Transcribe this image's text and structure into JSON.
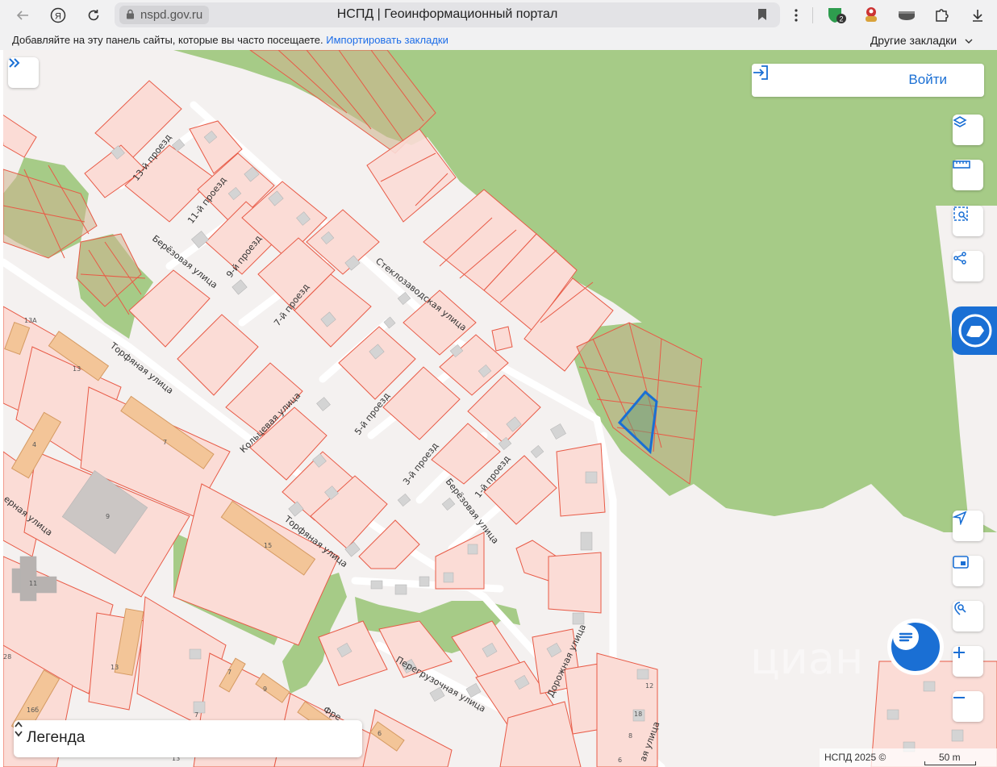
{
  "browser": {
    "url": "nspd.gov.ru",
    "title": "НСПД | Геоинформационный портал",
    "bookmarks_hint": "Добавляйте на эту панель сайты, которые вы часто посещаете.",
    "import_link": "Импортировать закладки",
    "other_bookmarks": "Другие закладки",
    "extension_badge": "2"
  },
  "map": {
    "login_label": "Войти",
    "legend_label": "Легенда",
    "copyright": "НСПД 2025 ©",
    "scale": "50 m",
    "watermark": "циан",
    "streets": {
      "s13": "13-й проезд",
      "s11": "11-й проезд",
      "s9": "9-й проезд",
      "s7": "7-й проезд",
      "s5": "5-й проезд",
      "s3": "3-й проезд",
      "s1": "1-й проезд",
      "berez1": "Берёзовая улица",
      "berez2": "Берёзовая улица",
      "steklo": "Стеклозаводская улица",
      "torf1": "Торфяная улица",
      "torf2": "Торфяная улица",
      "kolts": "Кольцевая улица",
      "pereg": "Перегрузочная улица",
      "dorozh": "Дорожная улица",
      "left1": "ерная улица",
      "left2": "Фре",
      "left3": "ая улица"
    },
    "buildings": [
      "13А",
      "13",
      "4",
      "7",
      "9",
      "11",
      "15",
      "13",
      "28",
      "16б",
      "7",
      "9",
      "7",
      "6",
      "12",
      "18",
      "8",
      "6",
      "13"
    ]
  },
  "icons": {
    "back": "back-arrow-icon",
    "yandex": "yandex-logo-icon",
    "reload": "reload-icon",
    "lock": "lock-icon",
    "bookmark": "bookmark-icon",
    "menu": "kebab-menu-icon",
    "download": "download-icon",
    "expand": "double-chevron-right-icon",
    "login": "login-icon",
    "layers": "layers-icon",
    "ruler": "ruler-icon",
    "select_area": "area-select-icon",
    "share": "share-icon",
    "navigate": "navigation-arrow-icon",
    "minimap": "minimap-icon",
    "locate": "geo-search-icon",
    "zoom_in": "zoom-in-icon",
    "zoom_out": "zoom-out-icon",
    "chat": "chat-icon"
  },
  "colors": {
    "forest": "#a6cb87",
    "parcel_fill": "#fbdcd6",
    "parcel_stroke": "#e85a46",
    "building": "#f3c598",
    "selected_parcel": "#1a6fd4",
    "accent": "#1a6fd4"
  }
}
